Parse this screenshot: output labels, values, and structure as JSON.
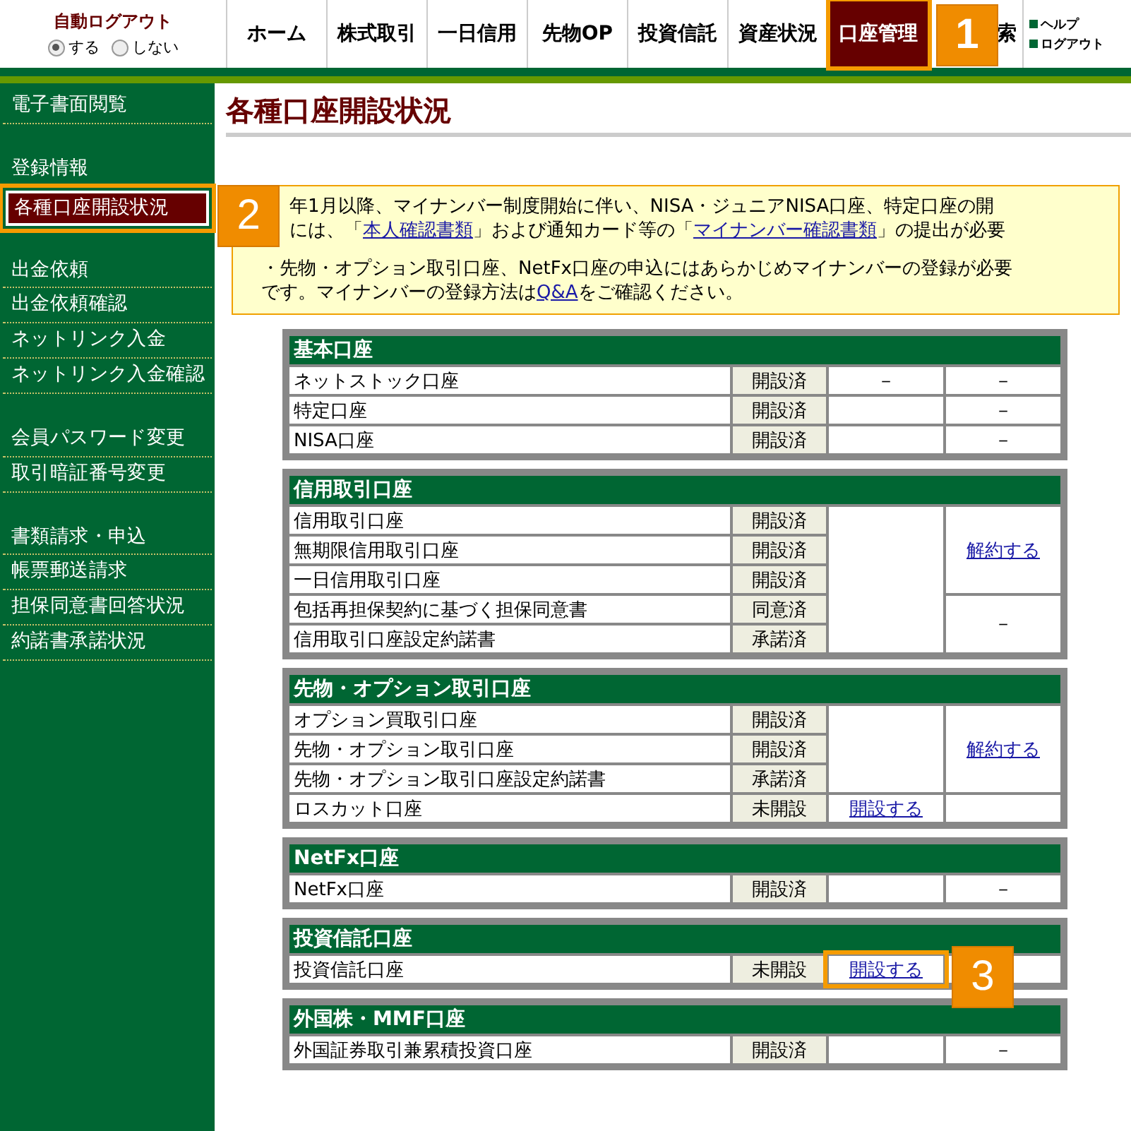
{
  "header": {
    "auto_logout": {
      "label": "自動ログアウト",
      "options": [
        {
          "label": "する",
          "selected": true
        },
        {
          "label": "しない",
          "selected": false
        }
      ]
    },
    "tabs": [
      {
        "label": "ホーム",
        "selected": false
      },
      {
        "label": "株式取引",
        "selected": false
      },
      {
        "label": "一日信用",
        "selected": false
      },
      {
        "label": "先物OP",
        "selected": false
      },
      {
        "label": "投資信託",
        "selected": false
      },
      {
        "label": "資産状況",
        "selected": false
      },
      {
        "label": "口座管理",
        "selected": true,
        "callout": "1"
      },
      {
        "label": "索",
        "selected": false
      }
    ],
    "links": [
      {
        "label": "ヘルプ"
      },
      {
        "label": "ログアウト"
      }
    ]
  },
  "sidebar": {
    "groups": [
      {
        "items": [
          {
            "label": "電子書面閲覧",
            "selected": false
          }
        ]
      },
      {
        "items": [
          {
            "label": "登録情報",
            "selected": false
          },
          {
            "label": "各種口座開設状況",
            "selected": true,
            "callout": "2"
          }
        ]
      },
      {
        "items": [
          {
            "label": "出金依頼",
            "selected": false
          },
          {
            "label": "出金依頼確認",
            "selected": false
          },
          {
            "label": "ネットリンク入金",
            "selected": false
          },
          {
            "label": "ネットリンク入金確認",
            "selected": false
          }
        ]
      },
      {
        "items": [
          {
            "label": "会員パスワード変更",
            "selected": false
          },
          {
            "label": "取引暗証番号変更",
            "selected": false
          }
        ]
      },
      {
        "items": [
          {
            "label": "書類請求・申込",
            "selected": false
          },
          {
            "label": "帳票郵送請求",
            "selected": false
          },
          {
            "label": "担保同意書回答状況",
            "selected": false
          },
          {
            "label": "約諾書承諾状況",
            "selected": false
          }
        ]
      }
    ]
  },
  "page_title": "各種口座開設状況",
  "notice": {
    "paragraphs": [
      {
        "indented": true,
        "lines": [
          [
            {
              "kind": "text",
              "text": "年1月以降、マイナンバー制度開始に伴い、NISA・ジュニアNISA口座、特定口座の開"
            }
          ],
          [
            {
              "kind": "text",
              "text": "には、「"
            },
            {
              "kind": "link",
              "text": "本人確認書類"
            },
            {
              "kind": "text",
              "text": "」および通知カード等の「"
            },
            {
              "kind": "link",
              "text": "マイナンバー確認書類"
            },
            {
              "kind": "text",
              "text": "」の提出が必要"
            }
          ]
        ]
      },
      {
        "indented": false,
        "lines": [
          [
            {
              "kind": "text",
              "text": "・先物・オプション取引口座、NetFx口座の申込にはあらかじめマイナンバーの登録が必要"
            }
          ],
          [
            {
              "kind": "text",
              "text": "です。マイナンバーの登録方法は"
            },
            {
              "kind": "link",
              "text": "Q&A"
            },
            {
              "kind": "text",
              "text": "をご確認ください。"
            }
          ]
        ]
      }
    ]
  },
  "sections": [
    {
      "title": "基本口座",
      "rows": [
        {
          "name": "ネットストック口座",
          "status": "開設済",
          "col3": {
            "kind": "text",
            "text": "－"
          },
          "col4": {
            "kind": "text",
            "text": "－"
          }
        },
        {
          "name": "特定口座",
          "status": "開設済",
          "col3": {
            "kind": "empty"
          },
          "col4": {
            "kind": "text",
            "text": "－"
          }
        },
        {
          "name": "NISA口座",
          "status": "開設済",
          "col3": {
            "kind": "empty"
          },
          "col4": {
            "kind": "text",
            "text": "－"
          }
        }
      ]
    },
    {
      "title": "信用取引口座",
      "rows": [
        {
          "name": "信用取引口座",
          "status": "開設済",
          "col3": {
            "kind": "empty"
          },
          "col4": {
            "kind": "link",
            "text": "解約する"
          }
        },
        {
          "name": "無期限信用取引口座",
          "status": "開設済"
        },
        {
          "name": "一日信用取引口座",
          "status": "開設済"
        },
        {
          "name": "包括再担保契約に基づく担保同意書",
          "status": "同意済",
          "col4": {
            "kind": "text",
            "text": "－"
          }
        },
        {
          "name": "信用取引口座設定約諾書",
          "status": "承諾済"
        }
      ]
    },
    {
      "title": "先物・オプション取引口座",
      "rows": [
        {
          "name": "オプション買取引口座",
          "status": "開設済",
          "col3": {
            "kind": "empty"
          },
          "col4": {
            "kind": "link",
            "text": "解約する"
          }
        },
        {
          "name": "先物・オプション取引口座",
          "status": "開設済"
        },
        {
          "name": "先物・オプション取引口座設定約諾書",
          "status": "承諾済"
        },
        {
          "name": "ロスカット口座",
          "status": "未開設",
          "col3": {
            "kind": "link",
            "text": "開設する"
          },
          "col4": {
            "kind": "empty"
          }
        }
      ]
    },
    {
      "title": "NetFx口座",
      "rows": [
        {
          "name": "NetFx口座",
          "status": "開設済",
          "col3": {
            "kind": "empty"
          },
          "col4": {
            "kind": "text",
            "text": "－"
          }
        }
      ]
    },
    {
      "title": "投資信託口座",
      "rows": [
        {
          "name": "投資信託口座",
          "status": "未開設",
          "col3": {
            "kind": "link",
            "text": "開設する",
            "callout": "3"
          },
          "col4": {
            "kind": "empty"
          }
        }
      ]
    },
    {
      "title": "外国株・MMF口座",
      "rows": [
        {
          "name": "外国証券取引兼累積投資口座",
          "status": "開設済",
          "col3": {
            "kind": "empty"
          },
          "col4": {
            "kind": "text",
            "text": "－"
          }
        }
      ]
    }
  ]
}
